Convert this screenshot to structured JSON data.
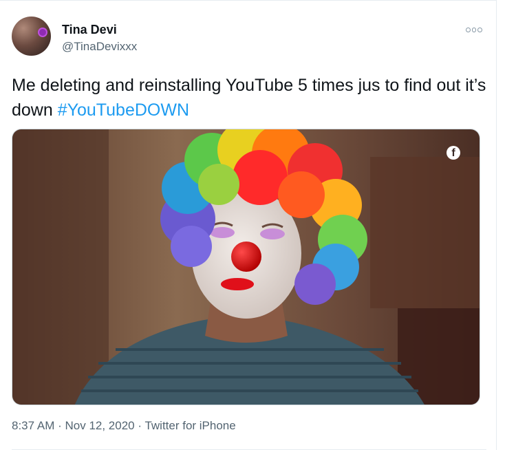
{
  "tweet": {
    "author_name": "Tina Devi",
    "author_handle": "@TinaDevixxx",
    "text": "Me deleting and reinstalling YouTube 5 times jus to find out it’s down ",
    "hashtag": "#YouTubeDOWN",
    "media_badge_letter": "f",
    "time": "8:37 AM",
    "separator": " · ",
    "date": "Nov 12, 2020",
    "source": "Twitter for iPhone"
  },
  "icons": {
    "more": "more-horizontal-icon",
    "facebook": "facebook-icon"
  },
  "colors": {
    "hashtag": "#1d9bf0",
    "secondary_text": "#536471"
  }
}
